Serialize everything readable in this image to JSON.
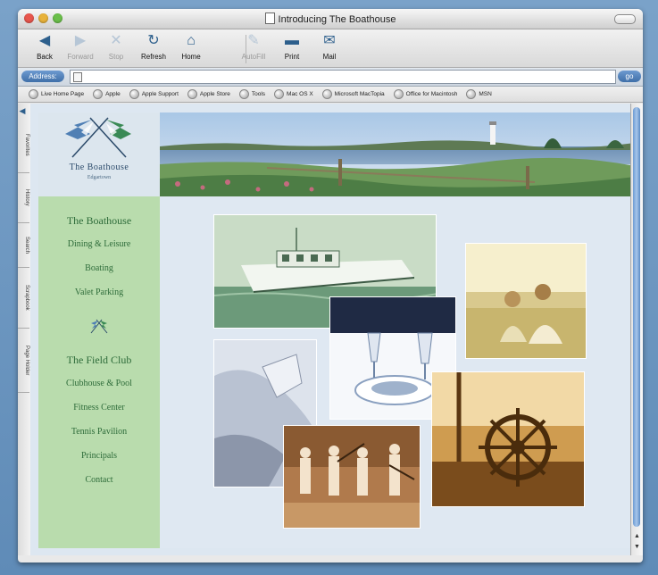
{
  "window": {
    "title": "Introducing The Boathouse"
  },
  "toolbar": {
    "back": "Back",
    "forward": "Forward",
    "stop": "Stop",
    "refresh": "Refresh",
    "home": "Home",
    "autofill": "AutoFill",
    "print": "Print",
    "mail": "Mail"
  },
  "address": {
    "label": "Address:",
    "value": "",
    "go": "go"
  },
  "favorites": [
    "Live Home Page",
    "Apple",
    "Apple Support",
    "Apple Store",
    "Tools",
    "Mac OS X",
    "Microsoft MacTopia",
    "Office for Macintosh",
    "MSN"
  ],
  "sidetabs": [
    "Favorites",
    "History",
    "Search",
    "Scrapbook",
    "Page Holder"
  ],
  "site": {
    "brand": "The Boathouse",
    "location": "Edgartown",
    "nav_group1": [
      "The Boathouse",
      "Dining & Leisure",
      "Boating",
      "Valet Parking"
    ],
    "nav_group2": [
      "The Field Club",
      "Clubhouse & Pool",
      "Fitness Center",
      "Tennis Pavilion",
      "Principals",
      "Contact"
    ]
  },
  "colors": {
    "accent": "#3f6fa8",
    "nav_bg": "#b9dcad",
    "nav_text": "#2e6c3a",
    "brand": "#2b4a6a"
  },
  "icons": {
    "back": "back-arrow-icon",
    "forward": "forward-arrow-icon",
    "stop": "stop-x-icon",
    "refresh": "refresh-icon",
    "home": "home-icon",
    "autofill": "pen-icon",
    "print": "printer-icon",
    "mail": "mail-icon"
  }
}
